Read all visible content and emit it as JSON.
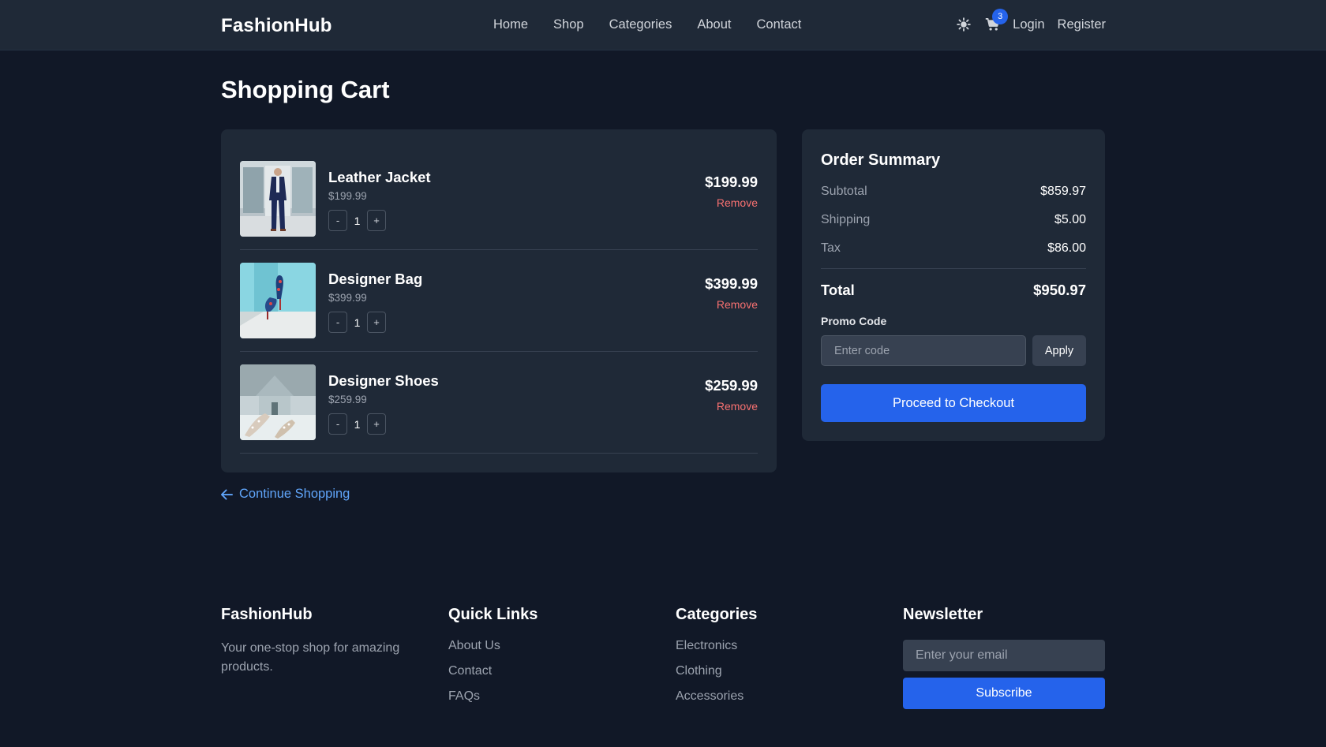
{
  "header": {
    "brand": "FashionHub",
    "nav": [
      "Home",
      "Shop",
      "Categories",
      "About",
      "Contact"
    ],
    "theme_icon": "sun-icon",
    "cart_icon": "cart-icon",
    "cart_count": "3",
    "login": "Login",
    "register": "Register"
  },
  "page_title": "Shopping Cart",
  "cart": {
    "items": [
      {
        "name": "Leather Jacket",
        "unit_price": "$199.99",
        "quantity": "1",
        "total": "$199.99",
        "remove": "Remove",
        "image": "man in navy suit photo"
      },
      {
        "name": "Designer Bag",
        "unit_price": "$399.99",
        "quantity": "1",
        "total": "$399.99",
        "remove": "Remove",
        "image": "blue floral heels photo"
      },
      {
        "name": "Designer Shoes",
        "unit_price": "$259.99",
        "quantity": "1",
        "total": "$259.99",
        "remove": "Remove",
        "image": "glitter heels in snow photo"
      }
    ],
    "decrement": "-",
    "increment": "+"
  },
  "continue_shopping": "Continue Shopping",
  "summary": {
    "title": "Order Summary",
    "subtotal_label": "Subtotal",
    "subtotal": "$859.97",
    "shipping_label": "Shipping",
    "shipping": "$5.00",
    "tax_label": "Tax",
    "tax": "$86.00",
    "total_label": "Total",
    "total": "$950.97",
    "promo_label": "Promo Code",
    "promo_placeholder": "Enter code",
    "apply": "Apply",
    "checkout": "Proceed to Checkout"
  },
  "footer": {
    "brand": "FashionHub",
    "tagline": "Your one-stop shop for amazing products.",
    "quick_links_title": "Quick Links",
    "quick_links": [
      "About Us",
      "Contact",
      "FAQs"
    ],
    "categories_title": "Categories",
    "categories": [
      "Electronics",
      "Clothing",
      "Accessories"
    ],
    "newsletter_title": "Newsletter",
    "newsletter_placeholder": "Enter your email",
    "subscribe": "Subscribe"
  },
  "colors": {
    "background": "#111827",
    "panel": "#1f2937",
    "accent": "#2563eb",
    "danger": "#f87171",
    "link": "#60a5fa"
  }
}
